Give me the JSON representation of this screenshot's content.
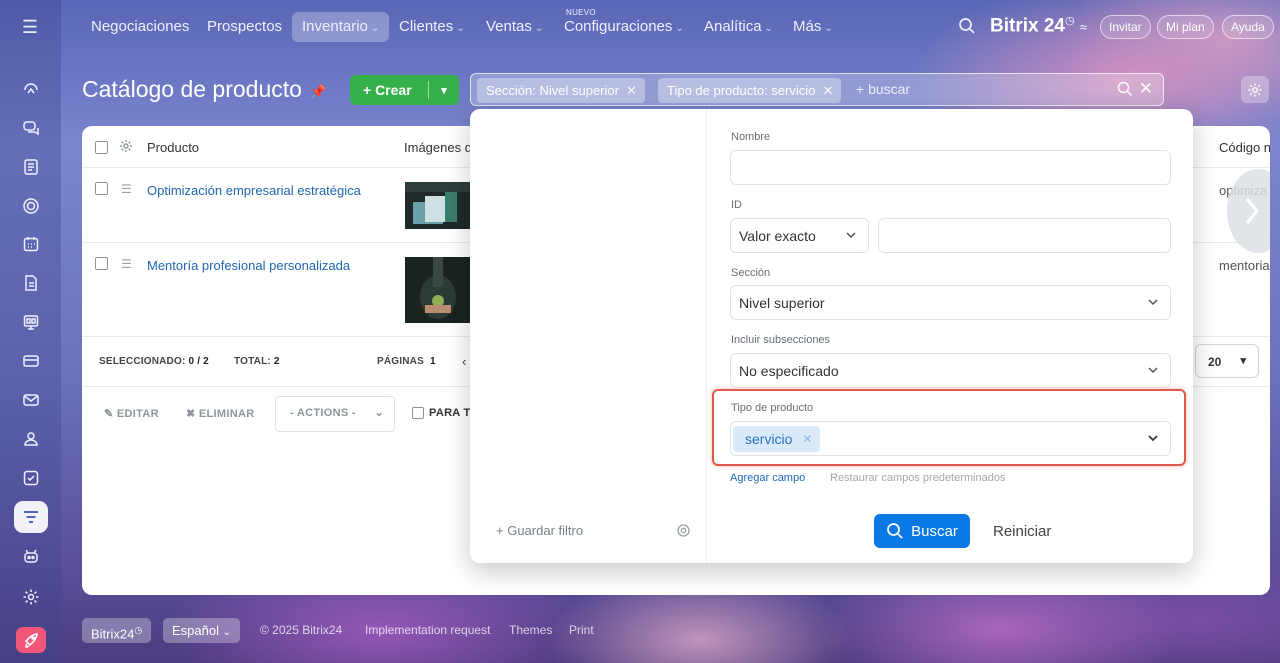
{
  "nav": {
    "items": [
      {
        "label": "Negociaciones",
        "chevron": ""
      },
      {
        "label": "Prospectos",
        "chevron": ""
      },
      {
        "label": "Inventario",
        "chevron": "⌄"
      },
      {
        "label": "Clientes",
        "chevron": "⌄"
      },
      {
        "label": "Ventas",
        "chevron": "⌄"
      },
      {
        "label": "Configuraciones",
        "chevron": "⌄"
      },
      {
        "label": "Analítica",
        "chevron": "⌄"
      },
      {
        "label": "Más",
        "chevron": "⌄"
      }
    ],
    "new_badge": "NUEVO",
    "brand": "Bitrix 24",
    "invite": "Invitar",
    "plan": "Mi plan",
    "help": "Ayuda"
  },
  "page": {
    "title": "Catálogo de producto",
    "create_label": "+ Crear"
  },
  "filterbar": {
    "tags": [
      {
        "label": "Sección: Nivel superior"
      },
      {
        "label": "Tipo de producto: servicio"
      }
    ],
    "search_placeholder": "+ buscar"
  },
  "grid": {
    "columns": {
      "product": "Producto",
      "images": "Imágenes d",
      "code": "Código n"
    },
    "rows": [
      {
        "name": "Optimización empresarial estratégica",
        "code": "optimiza"
      },
      {
        "name": "Mentoría profesional personalizada",
        "code": "mentoria"
      }
    ],
    "footer": {
      "selected_label": "SELECCIONADO:",
      "selected_value": "0 / 2",
      "total_label": "TOTAL:",
      "total_value": "2",
      "pages_label": "PÁGINAS",
      "pages_value": "1",
      "per_page": "20"
    },
    "actions": {
      "edit": "EDITAR",
      "delete": "ELIMINAR",
      "actions_select": "- ACTIONS -",
      "for_all": "PARA T"
    }
  },
  "filter_popup": {
    "save_filter": "+ Guardar filtro",
    "fields": {
      "name_label": "Nombre",
      "id_label": "ID",
      "id_mode": "Valor exacto",
      "section_label": "Sección",
      "section_value": "Nivel superior",
      "subsections_label": "Incluir subsecciones",
      "subsections_value": "No especificado",
      "type_label": "Tipo de producto",
      "type_tag": "servicio"
    },
    "add_field": "Agregar campo",
    "restore_fields": "Restaurar campos predeterminados",
    "search_button": "Buscar",
    "reset_button": "Reiniciar"
  },
  "bottom": {
    "brand": "Bitrix24",
    "language": "Español",
    "copyright": "© 2025 Bitrix24",
    "implementation": "Implementation request",
    "themes": "Themes",
    "print": "Print"
  },
  "colors": {
    "accent_blue": "#0a79e6",
    "create_green": "#35b04a",
    "link_blue": "#2066b0",
    "highlight_red": "#de5a4c"
  },
  "icons": [
    "menu-icon",
    "pulse-icon",
    "chat-icon",
    "feed-icon",
    "target-icon",
    "calendar-icon",
    "document-icon",
    "board-icon",
    "card-icon",
    "mail-icon",
    "contacts-icon",
    "tasks-icon",
    "filter-funnel-icon",
    "robot-icon",
    "settings-icon",
    "rocket-icon"
  ]
}
